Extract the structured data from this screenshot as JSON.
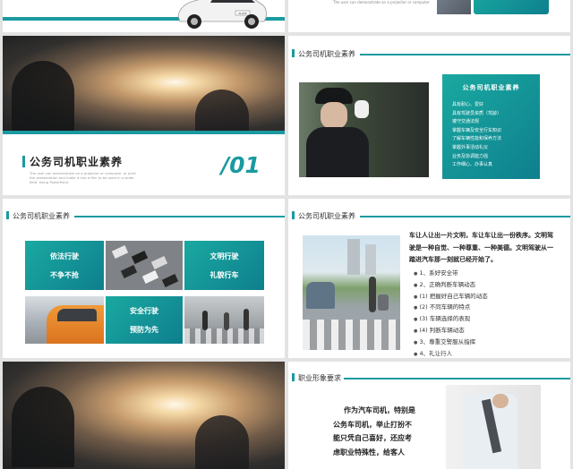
{
  "colors": {
    "accent": "#14a0a0",
    "accent_dark": "#0e7f8e",
    "text": "#333333"
  },
  "slide_top_left": {
    "plate": "PLATE"
  },
  "slide_top_right": {
    "tagline": "The user can demonstrate on a projector or computer"
  },
  "slide_cover": {
    "title": "公务司机职业素养",
    "subtitle_lines": [
      "The user can demonstrate on a projector or computer, or print",
      "the presentation and make it into a film to be used in a wider",
      "field. Using PowerPoint"
    ],
    "number": "/01"
  },
  "slide_chauffeur": {
    "header": "公务司机职业素养",
    "box_title": "公务司机职业素养",
    "items": [
      "具有耐心、爱好",
      "具有驾驶员资质（驾龄）",
      "遵守交通法规",
      "掌握车辆及安全行车知识",
      "了解车辆性能和保养方法",
      "掌握外事活动礼仪",
      "业务及协调能力强",
      "工作细心、办事认真"
    ]
  },
  "slide_grid": {
    "header": "公务司机职业素养",
    "tiles": [
      {
        "line1": "依法行驶",
        "line2": "不争不抢"
      },
      {
        "line1": "文明行驶",
        "line2": "礼貌行车"
      },
      {
        "line1": "安全行驶",
        "line2": "预防为先"
      }
    ]
  },
  "slide_crosswalk": {
    "header": "公务司机职业素养",
    "intro": "车让人让出一片文明，车让车让出一份秩序。文明驾驶是一种自觉、一种尊重、一种美德。文明驾驶从一踏进汽车那一刻就已经开始了。",
    "intro_lines": [
      "车让人让出一片文明，车让车让出一份秩序。文明驾",
      "驶是一种自觉、一种尊重、一种美德。文明驾驶从一",
      "踏进汽车那一刻就已经开始了。"
    ],
    "items": [
      "1、系好安全带",
      "2、正确判断车辆动态",
      "(1) 把握好自己车辆的动态",
      "(2) 不同车辆的特点",
      "(3) 车辆选择的表现",
      "(4) 判断车辆动态",
      "3、尊重交警服从指挥",
      "4、礼让行人"
    ]
  },
  "slide_image_bottom": {},
  "slide_image_requirement": {
    "header": "职业形象要求",
    "body_lines": [
      "作为汽车司机，特别是",
      "公务车司机，举止打扮不",
      "能只凭自己喜好，还应考",
      "虑职业特殊性，给客人"
    ]
  }
}
